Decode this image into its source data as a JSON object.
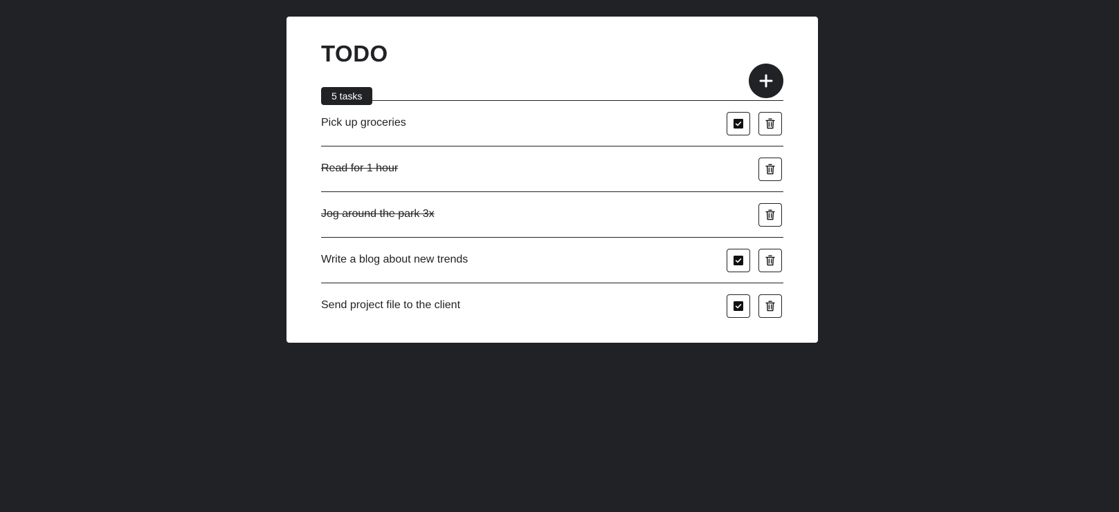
{
  "app": {
    "title": "TODO",
    "task_count_label": "5 tasks",
    "add_button_icon": "plus-icon"
  },
  "colors": {
    "background": "#212226",
    "card": "#ffffff",
    "accent": "#212226"
  },
  "tasks": [
    {
      "text": "Pick up groceries",
      "completed": false,
      "actions": [
        "check-icon",
        "trash-icon"
      ]
    },
    {
      "text": "Read for 1 hour",
      "completed": true,
      "actions": [
        "trash-icon"
      ]
    },
    {
      "text": "Jog around the park 3x",
      "completed": true,
      "actions": [
        "trash-icon"
      ]
    },
    {
      "text": "Write a blog about new trends",
      "completed": false,
      "actions": [
        "check-icon",
        "trash-icon"
      ]
    },
    {
      "text": "Send project file to the client",
      "completed": false,
      "actions": [
        "check-icon",
        "trash-icon"
      ]
    }
  ]
}
